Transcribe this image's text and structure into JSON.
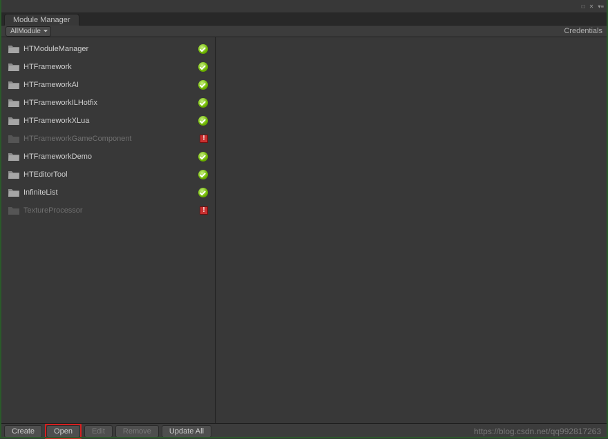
{
  "window": {
    "tab_title": "Module Manager"
  },
  "toolbar": {
    "filter_label": "AllModule",
    "credentials_label": "Credentials"
  },
  "modules": [
    {
      "name": "HTModuleManager",
      "status": "ok",
      "disabled": false
    },
    {
      "name": "HTFramework",
      "status": "ok",
      "disabled": false
    },
    {
      "name": "HTFrameworkAI",
      "status": "ok",
      "disabled": false
    },
    {
      "name": "HTFrameworkILHotfix",
      "status": "ok",
      "disabled": false
    },
    {
      "name": "HTFrameworkXLua",
      "status": "ok",
      "disabled": false
    },
    {
      "name": "HTFrameworkGameComponent",
      "status": "error",
      "disabled": true
    },
    {
      "name": "HTFrameworkDemo",
      "status": "ok",
      "disabled": false
    },
    {
      "name": "HTEditorTool",
      "status": "ok",
      "disabled": false
    },
    {
      "name": "InfiniteList",
      "status": "ok",
      "disabled": false
    },
    {
      "name": "TextureProcessor",
      "status": "error",
      "disabled": true
    }
  ],
  "footer": {
    "create": "Create",
    "open": "Open",
    "edit": "Edit",
    "remove": "Remove",
    "update_all": "Update All"
  },
  "watermark": "https://blog.csdn.net/qq992817263"
}
